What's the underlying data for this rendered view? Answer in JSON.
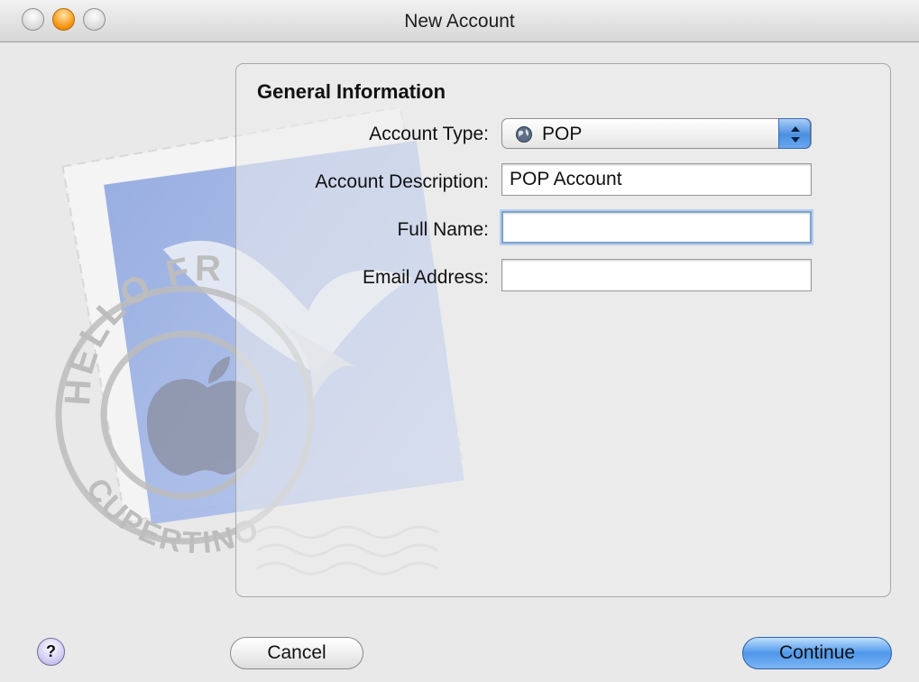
{
  "window": {
    "title": "New Account"
  },
  "form": {
    "section_title": "General Information",
    "account_type": {
      "label": "Account Type:",
      "value": "POP",
      "icon": "globe-icon"
    },
    "account_description": {
      "label": "Account Description:",
      "value": "POP Account"
    },
    "full_name": {
      "label": "Full Name:",
      "value": ""
    },
    "email_address": {
      "label": "Email Address:",
      "value": ""
    }
  },
  "buttons": {
    "help": "?",
    "cancel": "Cancel",
    "continue": "Continue"
  },
  "artwork": {
    "stamp_top": "HELLO FR",
    "stamp_bottom": "CUPERTINO CA"
  },
  "colors": {
    "accent": "#4f97ea",
    "panel_border": "#a9a9a9"
  }
}
